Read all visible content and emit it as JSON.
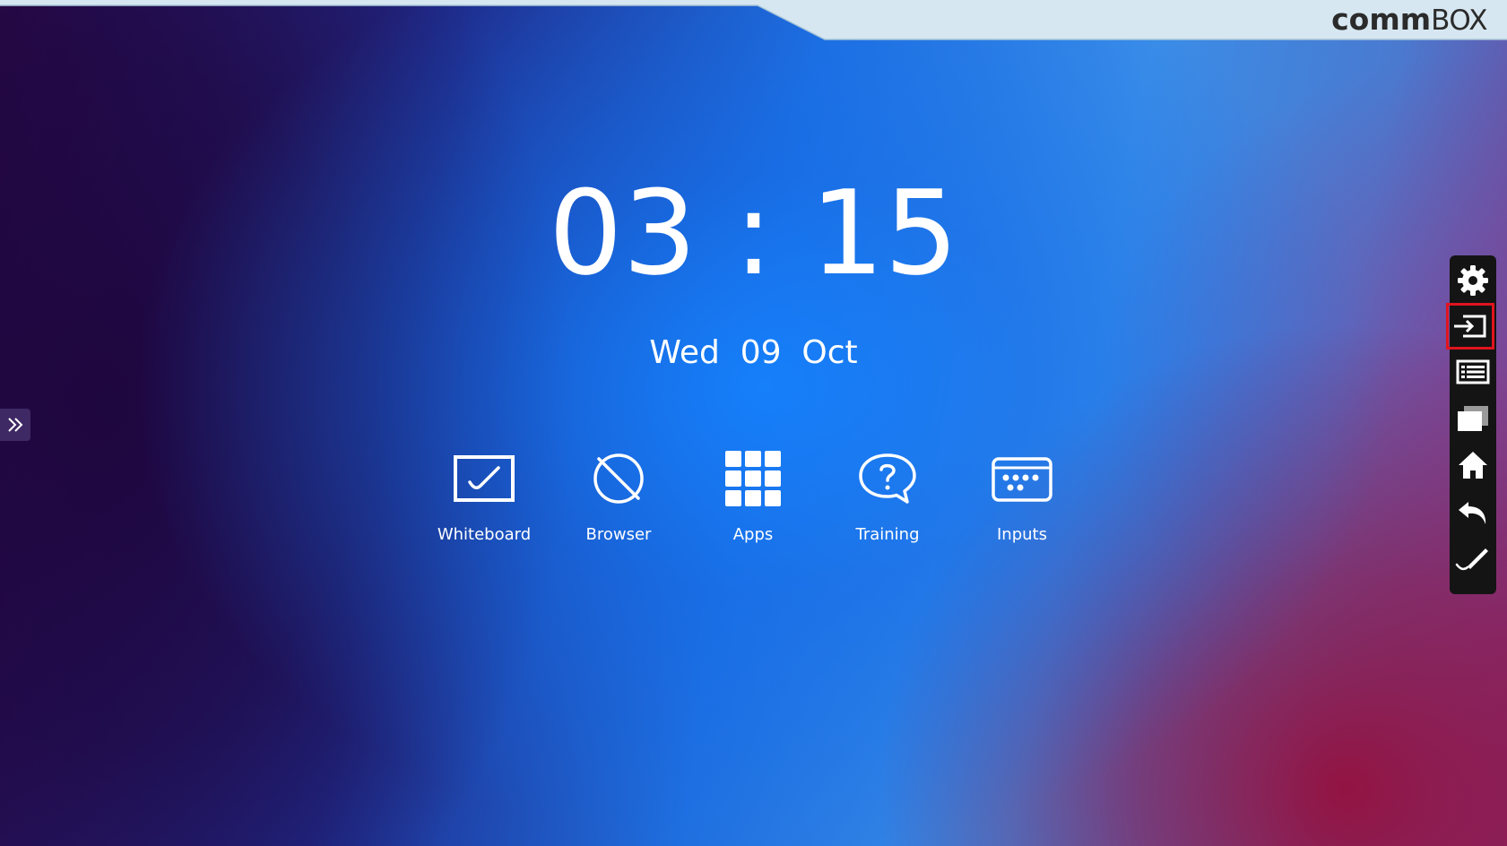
{
  "brand": {
    "name_bold": "comm",
    "name_light": "BOX"
  },
  "clock": {
    "time": "03 : 15",
    "date": "Wed  09  Oct"
  },
  "launcher": {
    "items": [
      {
        "label": "Whiteboard",
        "icon": "whiteboard-icon"
      },
      {
        "label": "Browser",
        "icon": "browser-icon"
      },
      {
        "label": "Apps",
        "icon": "apps-grid-icon"
      },
      {
        "label": "Training",
        "icon": "help-bubble-icon"
      },
      {
        "label": "Inputs",
        "icon": "inputs-icon"
      }
    ]
  },
  "sidebar_tab": {
    "icon": "double-chevron-right-icon"
  },
  "toolbar": {
    "items": [
      {
        "name": "settings",
        "icon": "gear-icon",
        "highlighted": false
      },
      {
        "name": "input-source",
        "icon": "input-source-icon",
        "highlighted": true
      },
      {
        "name": "menu",
        "icon": "list-icon",
        "highlighted": false
      },
      {
        "name": "windows",
        "icon": "windows-icon",
        "highlighted": false
      },
      {
        "name": "home",
        "icon": "home-icon",
        "highlighted": false
      },
      {
        "name": "back",
        "icon": "back-arrow-icon",
        "highlighted": false
      },
      {
        "name": "annotate",
        "icon": "pen-icon",
        "highlighted": false
      }
    ],
    "highlight_color": "#e0141e"
  },
  "colors": {
    "header_strip": "#d6e7f1",
    "toolbar_bg": "#141414",
    "text": "#ffffff"
  }
}
